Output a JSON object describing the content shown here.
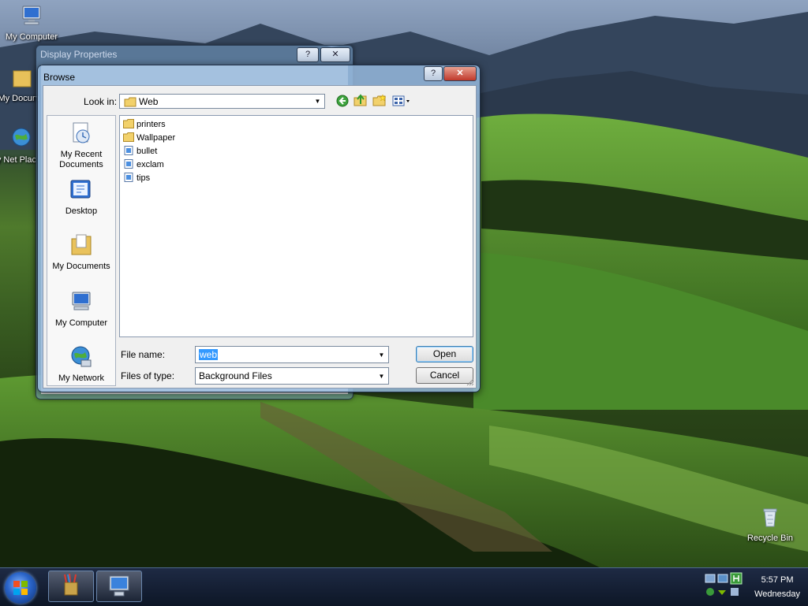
{
  "desktop": {
    "icons": [
      {
        "label": "My Computer"
      },
      {
        "label": "My Docum"
      },
      {
        "label": "My Net Plac"
      },
      {
        "label": "Recycle Bin"
      }
    ]
  },
  "back_window": {
    "title": "Display Properties",
    "help_label": "?",
    "close_label": "✕"
  },
  "dialog": {
    "title": "Browse",
    "help_label": "?",
    "close_label": "✕",
    "look_in_label": "Look in:",
    "look_in_value": "Web",
    "places": [
      {
        "label": "My Recent Documents"
      },
      {
        "label": "Desktop"
      },
      {
        "label": "My Documents"
      },
      {
        "label": "My Computer"
      },
      {
        "label": "My Network"
      }
    ],
    "files": [
      {
        "name": "printers",
        "type": "folder"
      },
      {
        "name": "Wallpaper",
        "type": "folder"
      },
      {
        "name": "bullet",
        "type": "file"
      },
      {
        "name": "exclam",
        "type": "file"
      },
      {
        "name": "tips",
        "type": "file"
      }
    ],
    "file_name_label": "File name:",
    "file_name_value": "web",
    "files_of_type_label": "Files of type:",
    "files_of_type_value": "Background Files",
    "open_label": "Open",
    "cancel_label": "Cancel"
  },
  "taskbar": {
    "time": "5:57 PM",
    "day": "Wednesday"
  }
}
